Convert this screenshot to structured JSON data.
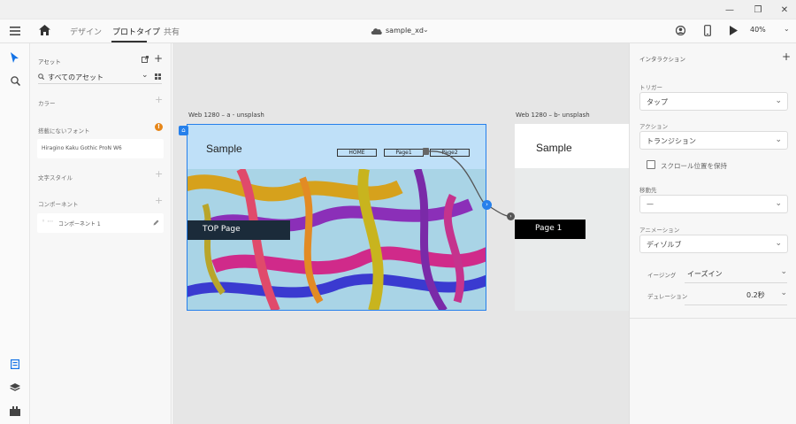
{
  "window": {
    "minimize": "—",
    "restore": "❐",
    "close": "✕"
  },
  "topbar": {
    "tabs": [
      {
        "label": "デザイン"
      },
      {
        "label": "プロトタイプ"
      },
      {
        "label": "共有"
      }
    ],
    "document_title": "sample_xd",
    "zoom": "40%"
  },
  "assets": {
    "title": "アセット",
    "search_label": "すべてのアセット",
    "colors_label": "カラー",
    "missing_fonts_label": "搭載にないフォント",
    "missing_font_name": "Hiragino Kaku Gothic ProN W6",
    "text_styles_label": "文字スタイル",
    "components_label": "コンポーネント",
    "component_item": "コンポーネント 1"
  },
  "canvas": {
    "artboard1": {
      "label": "Web 1280 – a - unsplash",
      "logo": "Sample",
      "nav": [
        "HOME",
        "Page1",
        "Page2"
      ],
      "hero_label": "TOP Page"
    },
    "artboard2": {
      "label": "Web 1280 – b- unsplash",
      "logo": "Sample",
      "hero_label": "Page 1"
    }
  },
  "properties": {
    "title": "インタラクション",
    "trigger_label": "トリガー",
    "trigger_value": "タップ",
    "action_label": "アクション",
    "action_value": "トランジション",
    "preserve_scroll_label": "スクロール位置を保持",
    "destination_label": "移動先",
    "destination_value": "—",
    "animation_label": "アニメーション",
    "animation_value": "ディゾルブ",
    "easing_label": "イージング",
    "easing_value": "イーズイン",
    "duration_label": "デュレーション",
    "duration_value": "0.2秒"
  }
}
